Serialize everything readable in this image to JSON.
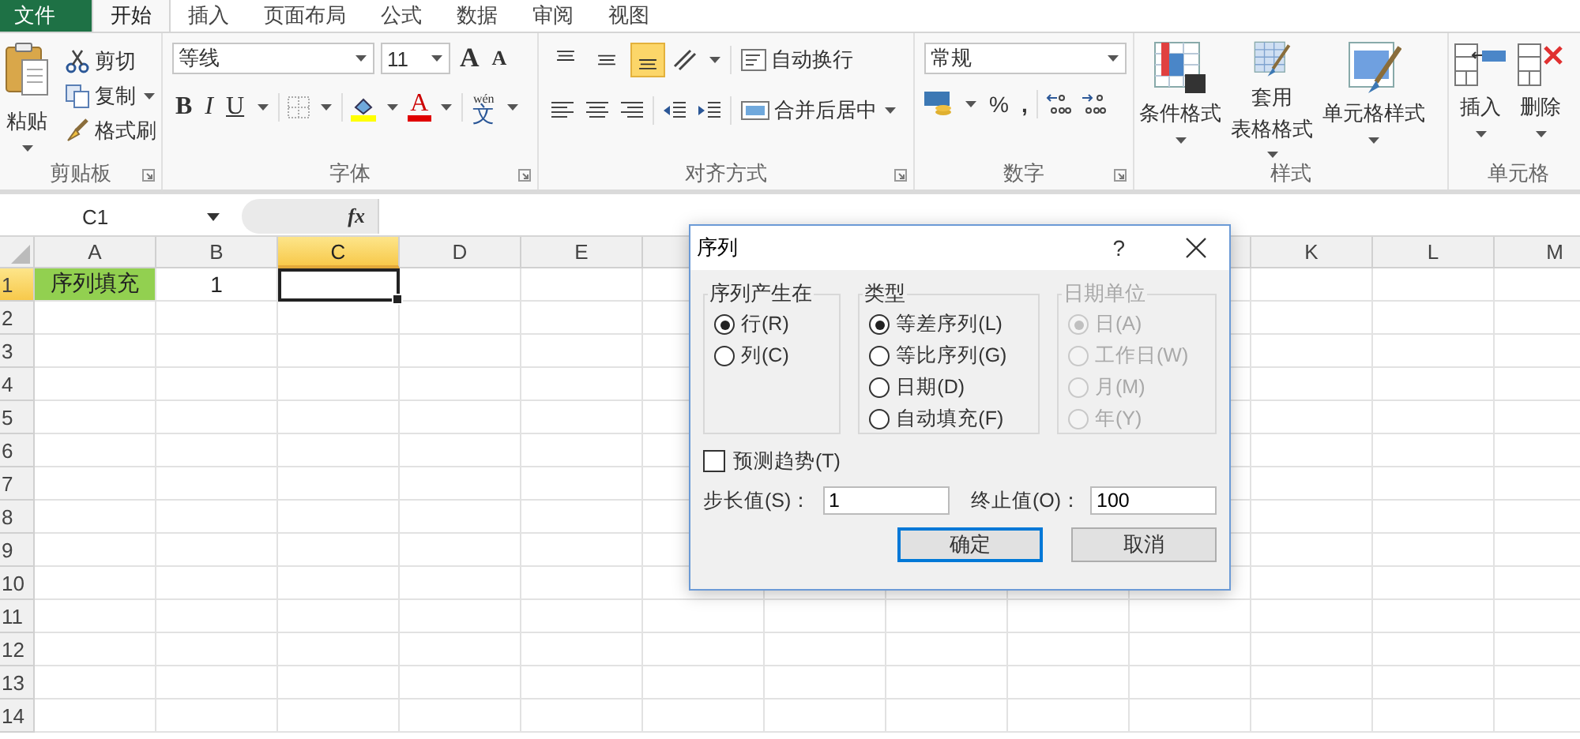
{
  "tabs": [
    {
      "label": "文件",
      "kind": "file",
      "selected": false
    },
    {
      "label": "开始",
      "kind": "tab",
      "selected": true
    },
    {
      "label": "插入",
      "kind": "tab",
      "selected": false
    },
    {
      "label": "页面布局",
      "kind": "tab",
      "selected": false
    },
    {
      "label": "公式",
      "kind": "tab",
      "selected": false
    },
    {
      "label": "数据",
      "kind": "tab",
      "selected": false
    },
    {
      "label": "审阅",
      "kind": "tab",
      "selected": false
    },
    {
      "label": "视图",
      "kind": "tab",
      "selected": false
    }
  ],
  "ribbon": {
    "clipboard": {
      "title": "剪贴板",
      "paste": "粘贴",
      "cut": "剪切",
      "copy": "复制",
      "format_painter": "格式刷"
    },
    "font": {
      "title": "字体",
      "font_name": "等线",
      "font_size": "11",
      "grow": "A",
      "shrink": "A",
      "bold": "B",
      "italic": "I",
      "underline": "U",
      "font_color": "A",
      "phonetic": "文",
      "phonetic_reading": "wén"
    },
    "alignment": {
      "title": "对齐方式",
      "wrap": "自动换行",
      "merge": "合并后居中",
      "vertical_align": [
        {
          "kind": "top",
          "selected": false
        },
        {
          "kind": "middle",
          "selected": false
        },
        {
          "kind": "bottom",
          "selected": true
        }
      ]
    },
    "number": {
      "title": "数字",
      "format": "常规",
      "percent": "%",
      "comma": ","
    },
    "styles": {
      "title": "样式",
      "conditional": "条件格式",
      "table_format": [
        "套用",
        "表格格式"
      ],
      "cell_styles": "单元格样式"
    },
    "cells": {
      "title": "单元格",
      "insert": "插入",
      "delete": "删除"
    }
  },
  "formula_bar": {
    "name_box": "C1",
    "fx": "fx"
  },
  "sheet": {
    "columns_left": [
      {
        "label": "A",
        "selected": false
      },
      {
        "label": "B",
        "selected": false
      },
      {
        "label": "C",
        "selected": true
      },
      {
        "label": "D",
        "selected": false
      },
      {
        "label": "E",
        "selected": false
      }
    ],
    "columns_right": [
      {
        "label": "K",
        "selected": false
      },
      {
        "label": "L",
        "selected": false
      },
      {
        "label": "M",
        "selected": false
      }
    ],
    "rows": [
      {
        "label": "1",
        "selected": true,
        "cells": [
          {
            "text": "序列填充",
            "color": "#92d050",
            "selected": false
          },
          {
            "text": "1",
            "selected": false
          },
          {
            "selected": true
          }
        ]
      },
      {
        "label": "2",
        "selected": false
      },
      {
        "label": "3",
        "selected": false
      },
      {
        "label": "4",
        "selected": false
      },
      {
        "label": "5",
        "selected": false
      },
      {
        "label": "6",
        "selected": false
      },
      {
        "label": "7",
        "selected": false
      },
      {
        "label": "8",
        "selected": false
      },
      {
        "label": "9",
        "selected": false
      },
      {
        "label": "10",
        "selected": false
      },
      {
        "label": "11",
        "selected": false
      },
      {
        "label": "12",
        "selected": false
      },
      {
        "label": "13",
        "selected": false
      },
      {
        "label": "14",
        "selected": false
      }
    ]
  },
  "dialog": {
    "title": "序列",
    "help": "?",
    "groups": [
      {
        "title": "序列产生在",
        "disabled": false,
        "options": [
          {
            "label": "行(R)",
            "selected": true
          },
          {
            "label": "列(C)",
            "selected": false
          }
        ]
      },
      {
        "title": "类型",
        "disabled": false,
        "options": [
          {
            "label": "等差序列(L)",
            "selected": true
          },
          {
            "label": "等比序列(G)",
            "selected": false
          },
          {
            "label": "日期(D)",
            "selected": false
          },
          {
            "label": "自动填充(F)",
            "selected": false
          }
        ]
      },
      {
        "title": "日期单位",
        "disabled": true,
        "options": [
          {
            "label": "日(A)",
            "selected": true
          },
          {
            "label": "工作日(W)",
            "selected": false
          },
          {
            "label": "月(M)",
            "selected": false
          },
          {
            "label": "年(Y)",
            "selected": false
          }
        ]
      }
    ],
    "trend": {
      "label": "预测趋势(T)",
      "checked": false
    },
    "fields": [
      {
        "label": "步长值(S)：",
        "value": "1"
      },
      {
        "label": "终止值(O)：",
        "value": "100"
      }
    ],
    "buttons": [
      {
        "label": "确定",
        "default": true
      },
      {
        "label": "取消",
        "default": false
      }
    ]
  }
}
